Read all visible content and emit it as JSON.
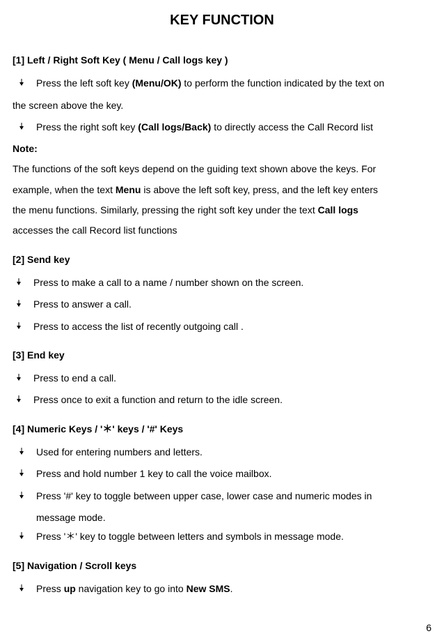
{
  "title": "KEY FUNCTION",
  "page_number": "6",
  "sec1": {
    "heading": "[1]  Left / Right Soft Key ( Menu / Call logs key )",
    "b1_a": "Press the left soft key ",
    "b1_bold": "(Menu/OK)",
    "b1_c": " to perform the function indicated by the text on",
    "b1_tail": "the screen above the key.",
    "b2_a": "Press the right soft key ",
    "b2_bold": "(Call logs/Back)",
    "b2_c": " to directly access the Call Record list",
    "note_label": "Note:",
    "note_p1a": "The functions of the soft keys depend on the guiding text shown above the keys. For",
    "note_p1b": "example, when the text ",
    "note_bold1": "Menu",
    "note_p1c": " is above the left soft key, press, and the left key enters",
    "note_p2a": "the menu functions. Similarly, pressing the right soft key under the text ",
    "note_bold2": "Call logs",
    "note_p3": "accesses the call Record list functions"
  },
  "sec2": {
    "heading": "[2]  Send key",
    "b1": "Press to make a call to a name / number shown on the screen.",
    "b2": "Press to answer a call.",
    "b3": "Press to access the list of recently outgoing call ."
  },
  "sec3": {
    "heading": "[3]  End key",
    "b1": "Press to end a call.",
    "b2": "Press once to exit a function and return to the idle screen."
  },
  "sec4": {
    "heading": "[4]  Numeric Keys / '＊' keys / '#' Keys",
    "b1": "Used for entering numbers and letters.",
    "b2": "Press and hold number 1 key to call the voice mailbox.",
    "b3a": "Press '#' key to toggle between upper case, lower case and numeric modes in",
    "b3b": "message mode.",
    "b4": "Press '＊' key to toggle between letters and symbols in message mode."
  },
  "sec5": {
    "heading": "[5]  Navigation / Scroll keys",
    "b1_a": "Press ",
    "b1_bold1": "up",
    "b1_b": " navigation key to go into ",
    "b1_bold2": "New SMS",
    "b1_c": "."
  }
}
